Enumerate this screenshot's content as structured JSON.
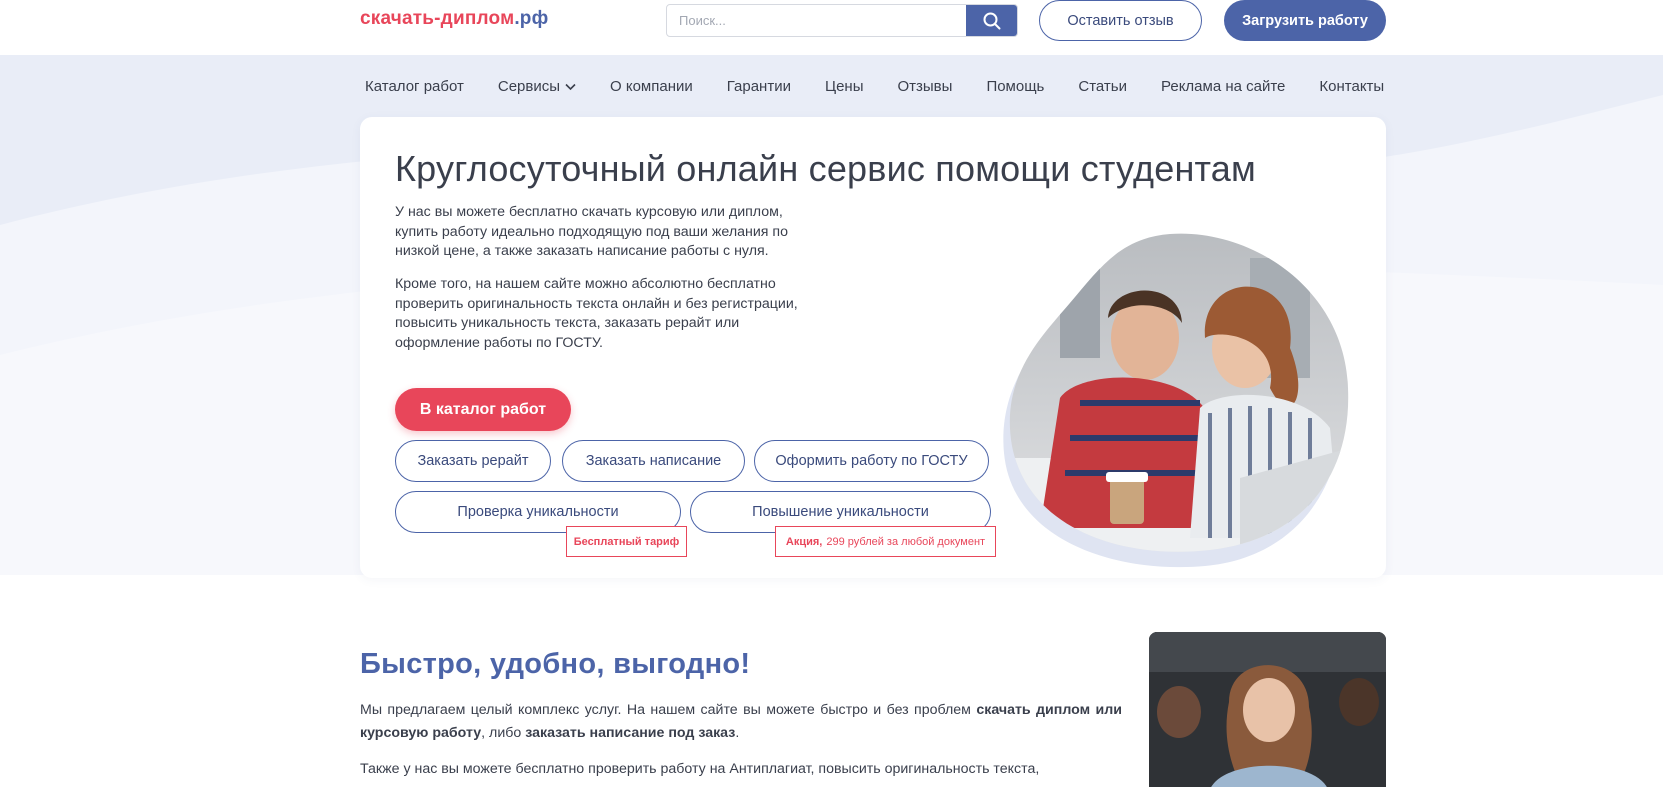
{
  "header": {
    "logo_part1": "скачать-диплом",
    "logo_part2": ".рф",
    "search_placeholder": "Поиск...",
    "review_button": "Оставить отзыв",
    "upload_button": "Загрузить работу"
  },
  "nav": {
    "items": [
      {
        "label": "Каталог работ"
      },
      {
        "label": "Сервисы"
      },
      {
        "label": "О компании"
      },
      {
        "label": "Гарантии"
      },
      {
        "label": "Цены"
      },
      {
        "label": "Отзывы"
      },
      {
        "label": "Помощь"
      },
      {
        "label": "Статьи"
      },
      {
        "label": "Реклама на сайте"
      },
      {
        "label": "Контакты"
      }
    ]
  },
  "hero": {
    "title": "Круглосуточный онлайн сервис помощи студентам",
    "paragraph1": "У нас вы можете бесплатно скачать курсовую или диплом, купить работу идеально подходящую под ваши желания по низкой цене, а также заказать написание работы с нуля.",
    "paragraph2": "Кроме того, на нашем сайте можно абсолютно бесплатно проверить оригинальность текста онлайн и без регистрации, повысить уникальность текста, заказать рерайт или оформление работы по ГОСТУ.",
    "catalog_button": "В каталог работ",
    "buttons": {
      "rewrite": "Заказать рерайт",
      "writing": "Заказать написание",
      "gost": "Оформить работу по ГОСТУ",
      "check": "Проверка уникальности",
      "boost": "Повышение уникальности"
    },
    "tag_free": "Бесплатный тариф",
    "tag_promo_bold": "Акция,",
    "tag_promo_text": "299 рублей за любой документ"
  },
  "section2": {
    "title": "Быстро, удобно, выгодно!",
    "p1_a": "Мы предлагаем целый комплекс услуг. На нашем сайте вы можете быстро и без проблем ",
    "p1_b": "скачать диплом или курсовую работу",
    "p1_c": ", либо ",
    "p1_d": "заказать написание под заказ",
    "p1_e": ".",
    "p2": "Также у нас вы можете бесплатно проверить работу на Антиплагиат, повысить оригинальность текста,"
  },
  "colors": {
    "brand_blue": "#4c64a8",
    "accent_red": "#e8465a",
    "hero_bg": "#e9edf7",
    "text": "#3a3f4c"
  }
}
